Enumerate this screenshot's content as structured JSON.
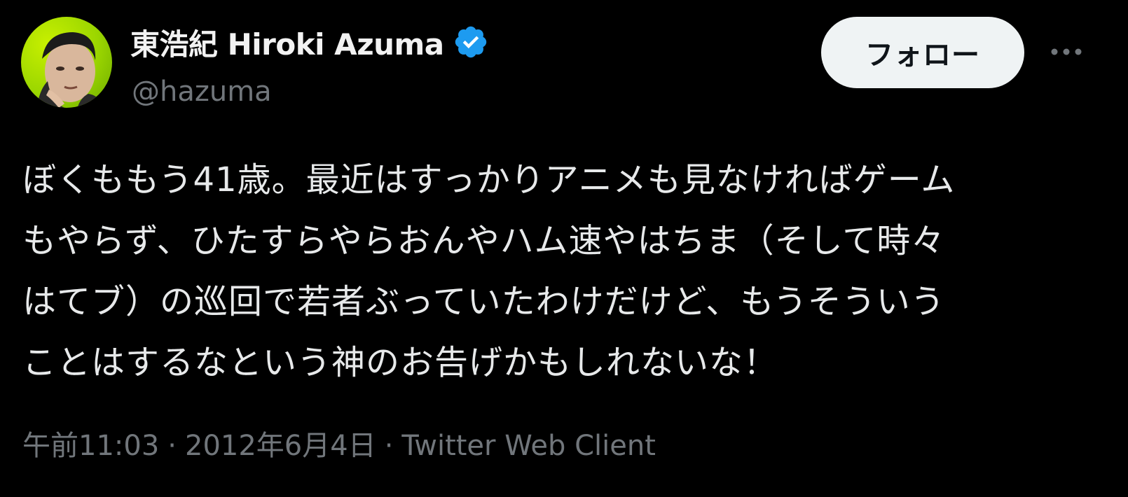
{
  "author": {
    "display_name": "東浩紀 Hiroki Azuma",
    "handle": "@hazuma",
    "verified_icon": "verified-badge-icon",
    "avatar_icon": "user-avatar"
  },
  "header": {
    "follow_label": "フォロー",
    "more_icon": "more-horizontal-icon"
  },
  "tweet": {
    "lines": [
      "ぼくももう41歳。最近はすっかりアニメも見なければゲーム",
      "もやらず、ひたすらやらおんやハム速やはちま（そして時々",
      "はてブ）の巡回で若者ぶっていたわけだけど、もうそういう",
      "ことはするなという神のお告げかもしれないな！"
    ]
  },
  "meta": {
    "time": "午前11:03",
    "separator": "·",
    "date": "2012年6月4日",
    "client": "Twitter Web Client"
  },
  "colors": {
    "background": "#000000",
    "text": "#e7e9ea",
    "muted": "#71767b",
    "verified": "#1d9bf0",
    "button_bg": "#eff3f4"
  }
}
